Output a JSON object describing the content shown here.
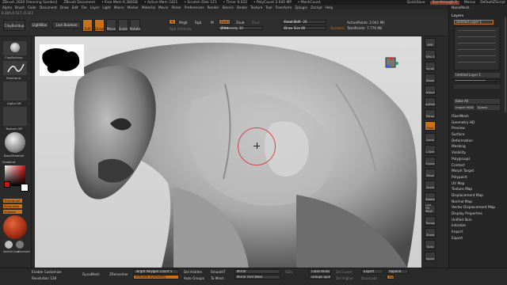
{
  "titlebar": {
    "title": "ZBrush 2020 [Henning Sanden]",
    "doc": "ZBrush Document",
    "freemem": "• Free Mem 6,380GB",
    "activemem": "• Active Mem 2421",
    "scratch": "• Scratch Disk 121",
    "timer": "• Timer 0.022",
    "polycount": "• PolyCount 2.045 MP",
    "meshcount": "• MeshCount",
    "quicksave": "QuickSave",
    "seethrough": "See-through 0",
    "menus": "Menus",
    "script": "DefaultZScript"
  },
  "menubar": [
    "Alpha",
    "Brush",
    "Color",
    "Document",
    "Draw",
    "Edit",
    "File",
    "Layer",
    "Light",
    "Macro",
    "Marker",
    "Material",
    "Movie",
    "Picker",
    "Preferences",
    "Render",
    "Stencil",
    "Stroke",
    "Texture",
    "Tool",
    "Transform",
    "Zplugin",
    "Zscript",
    "Help"
  ],
  "coords": "0.285,0.517,-0.321",
  "toolbar": {
    "brush_label": "ClayBuildup",
    "lightbox": "LightBox",
    "live_boolean": "Live Boolean",
    "edit": "Edit",
    "draw": "Draw",
    "move": "Move",
    "scale": "Scale",
    "rotate": "Rotate",
    "a_label": "A",
    "mrgb": "Mrgb",
    "rgb": "Rgb",
    "m": "M",
    "rgb_intensity": "Rgb Intensity",
    "zadd": "Zadd",
    "zsub": "Zsub",
    "zcut": "Zcut",
    "z_intensity": "Z Intensity 20",
    "z_intensity_value": 0.2,
    "focal_shift": "Focal Shift -26",
    "focal_shift_value": 0.37,
    "draw_size": "Draw Size 80",
    "draw_size_value": 0.08,
    "dynamic": "Dynamic",
    "active_points": "ActivePoints: 2.041 Mil",
    "total_points": "TotalPoints: 7.776 Mil"
  },
  "lefttray": {
    "brush_name": "ClayBuildup",
    "stroke_name": "FreeHand",
    "alpha": "Alpha Off",
    "texture": "Texture Off",
    "material": "BasicMaterial",
    "gradient": "Gradient",
    "switchcolor": "SwitchColor",
    "alternate": "Alternate",
    "thumbnail": "Thumbnail",
    "silhouette": "Silhouette",
    "shadow": "Shadow"
  },
  "palette": {
    "header": "NanoMesh",
    "layers_title": "Layers",
    "layer_name": "Untitled Layer 1",
    "layer2_name": "Untitled Layer 1",
    "bake_all": "Bake All",
    "import_mdd": "Import MDD",
    "speed": "Speed"
  },
  "palette_list": [
    "FiberMesh",
    "Geometry HD",
    "Preview",
    "Surface",
    "Deformation",
    "Masking",
    "Visibility",
    "Polygroups",
    "Contact",
    "Morph Target",
    "Polypaint",
    "UV Map",
    "Texture Map",
    "Displacement Map",
    "Normal Map",
    "Vector Displacement Map",
    "Display Properties",
    "Unified Skin",
    "Initialize",
    "Import",
    "Export"
  ],
  "rightshelf": [
    "BPR",
    "SPix 3",
    "Scroll",
    "Zoom",
    "Actual",
    "AAHalf",
    "Persp",
    "Floor",
    "Local",
    "L.Sym",
    "Frame",
    "Move",
    "Scale",
    "Rotate",
    "Line Fill PolyF",
    "Transp",
    "Ghost",
    "Solo",
    "Xpose"
  ],
  "bottombar": {
    "enable_customize": "Enable Customize",
    "dynamesh": "DynaMesh",
    "resolution": "Resolution 128",
    "zremesher": "ZRemesher",
    "target_polycount": "Target Polygon Count 5",
    "activate_symmetry": "Activate Symmetry",
    "del_hidden": "Del Hidden",
    "auto_groups": "Auto Groups",
    "sdiv": "SmoothT",
    "to_mesh": "To Mesh",
    "mirror": "Mirror",
    "mirror_weld": "Mirror And Weld",
    "sdiv_label": "SDiv",
    "close_holes": "Close Holes",
    "groups_split": "Groups Split",
    "del_lower": "Del Lower",
    "del_higher": "Del Higher",
    "export": "Export",
    "append": "Append",
    "duplicate": "Duplicate",
    "zd": "ZD"
  },
  "colors": {
    "accent": "#c9711a",
    "brush_ring": "#cc4a4a",
    "viewport_bg": "#d9d9d9"
  }
}
